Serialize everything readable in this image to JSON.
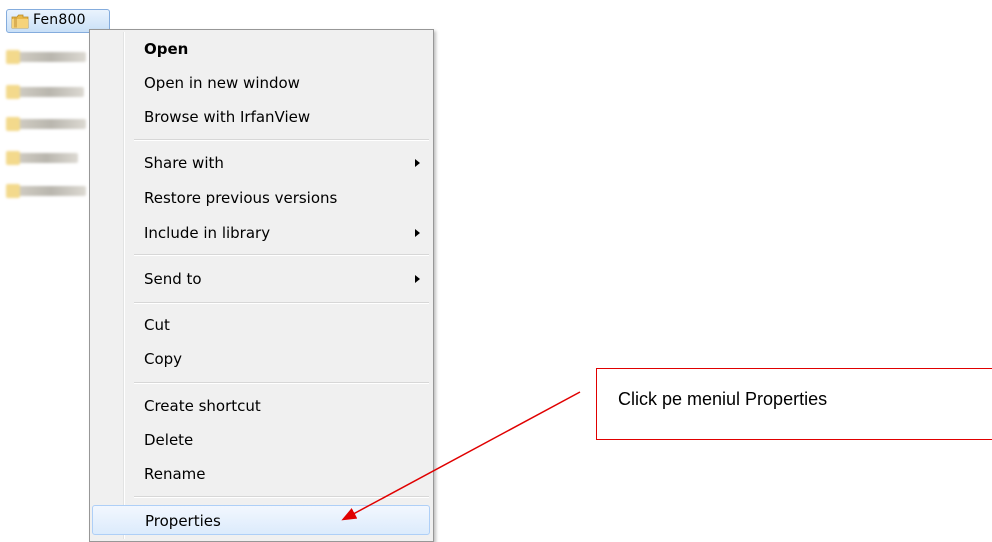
{
  "explorer": {
    "selected_folder": "Fen800"
  },
  "context_menu": {
    "items": [
      {
        "label": "Open"
      },
      {
        "label": "Open in new window"
      },
      {
        "label": "Browse with IrfanView"
      },
      {
        "label": "Share with",
        "has_submenu": true
      },
      {
        "label": "Restore previous versions"
      },
      {
        "label": "Include in library",
        "has_submenu": true
      },
      {
        "label": "Send to",
        "has_submenu": true
      },
      {
        "label": "Cut"
      },
      {
        "label": "Copy"
      },
      {
        "label": "Create shortcut"
      },
      {
        "label": "Delete"
      },
      {
        "label": "Rename"
      },
      {
        "label": "Properties",
        "highlighted": true
      }
    ]
  },
  "annotation": {
    "text": "Click pe meniul Properties",
    "color": "#e00000"
  },
  "colors": {
    "menu_background": "#f0f0f0",
    "highlight_border": "#aecff7",
    "folder_yellow": "#e8b84a"
  }
}
